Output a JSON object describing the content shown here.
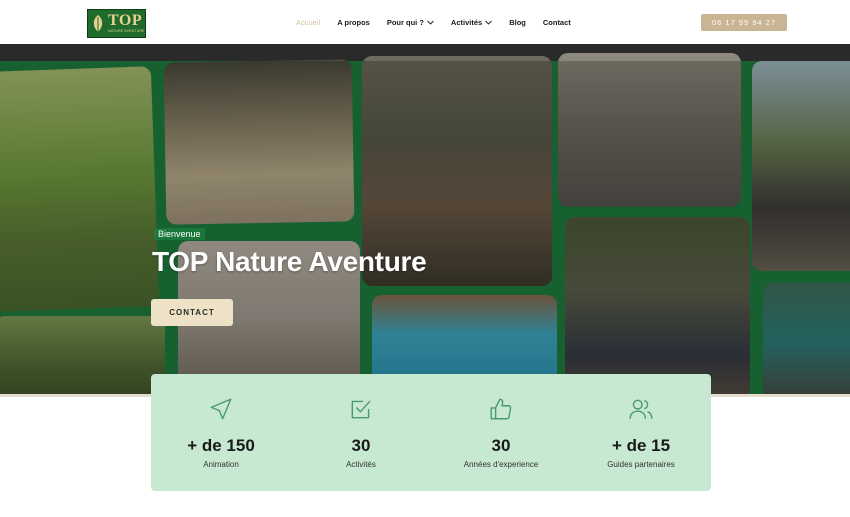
{
  "header": {
    "logo": {
      "text": "TOP",
      "subtitle": "NATURE AVENTURE"
    },
    "nav": [
      {
        "label": "Accueil",
        "active": true,
        "dropdown": false
      },
      {
        "label": "A propos",
        "active": false,
        "dropdown": false
      },
      {
        "label": "Pour qui ?",
        "active": false,
        "dropdown": true
      },
      {
        "label": "Activités",
        "active": false,
        "dropdown": true
      },
      {
        "label": "Blog",
        "active": false,
        "dropdown": false
      },
      {
        "label": "Contact",
        "active": false,
        "dropdown": false
      }
    ],
    "phone": "06 17 99 94 27"
  },
  "hero": {
    "badge": "Bienvenue",
    "title": "TOP Nature Aventure",
    "cta": "CONTACT"
  },
  "stats": [
    {
      "icon": "paper-plane-icon",
      "value": "+ de 150",
      "label": "Animation"
    },
    {
      "icon": "checkbox-icon",
      "value": "30",
      "label": "Activités"
    },
    {
      "icon": "thumbs-up-icon",
      "value": "30",
      "label": "Années d'experience"
    },
    {
      "icon": "users-icon",
      "value": "+ de 15",
      "label": "Guides partenaires"
    }
  ],
  "colors": {
    "brand_green": "#1e7d3e",
    "gold": "#c9b593",
    "stats_bg": "#c7e8d1",
    "active_nav": "#d4c3a0"
  }
}
